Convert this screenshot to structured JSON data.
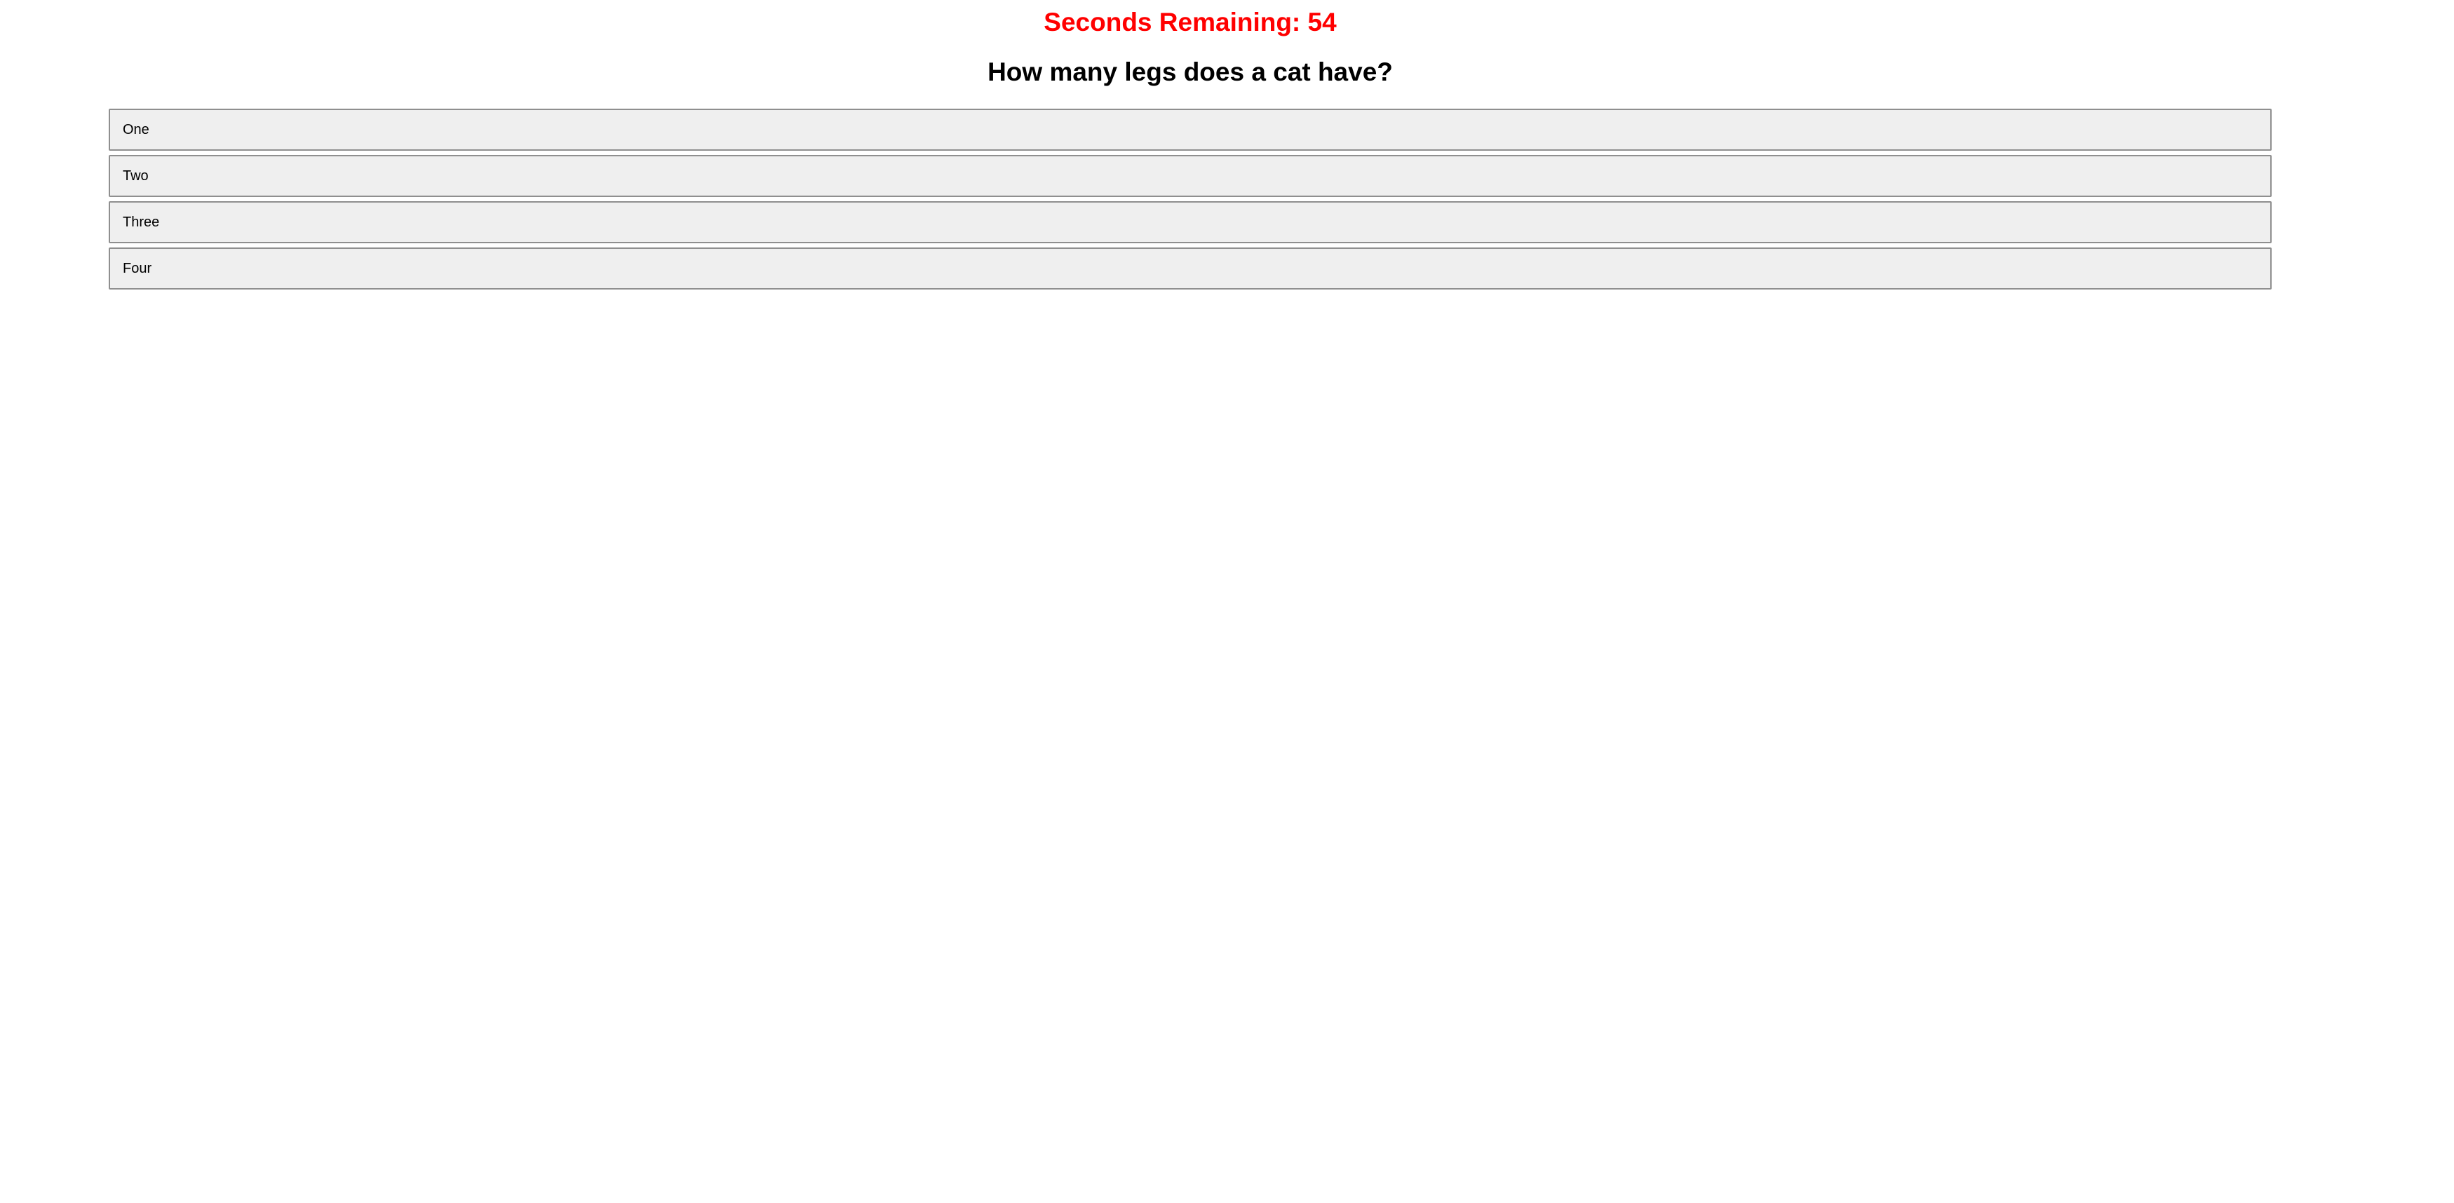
{
  "timer": {
    "label": "Seconds Remaining: 54",
    "color": "#ff0000"
  },
  "question": {
    "text": "How many legs does a cat have?"
  },
  "answers": [
    {
      "label": "One"
    },
    {
      "label": "Two"
    },
    {
      "label": "Three"
    },
    {
      "label": "Four"
    }
  ]
}
